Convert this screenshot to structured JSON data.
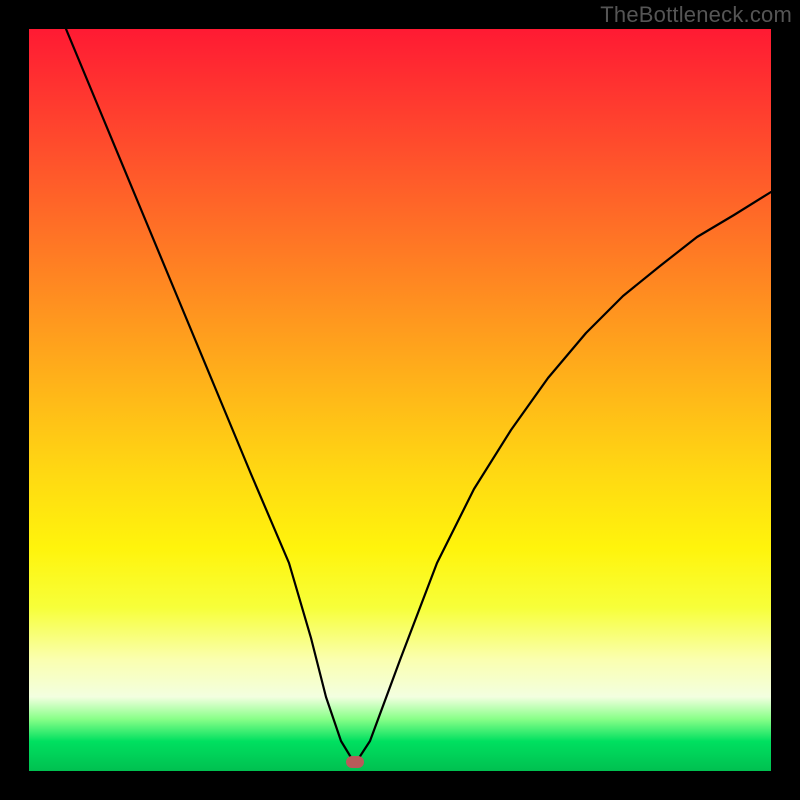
{
  "watermark": "TheBottleneck.com",
  "chart_data": {
    "type": "line",
    "title": "",
    "xlabel": "",
    "ylabel": "",
    "xlim": [
      0,
      100
    ],
    "ylim": [
      0,
      100
    ],
    "x": [
      5,
      10,
      15,
      20,
      25,
      30,
      35,
      38,
      40,
      42,
      44,
      46,
      50,
      55,
      60,
      65,
      70,
      75,
      80,
      85,
      90,
      95,
      100
    ],
    "values": [
      100,
      88,
      76,
      64,
      52,
      40,
      28,
      18,
      10,
      4,
      1,
      4,
      15,
      28,
      38,
      46,
      53,
      59,
      64,
      68,
      72,
      75,
      78
    ],
    "minimum_x": 44,
    "minimum_y": 1,
    "background": "red-orange-yellow-green vertical gradient (high=red top, low=green bottom)",
    "marker": {
      "x": 44,
      "y": 1,
      "color": "#b85a5a"
    }
  }
}
